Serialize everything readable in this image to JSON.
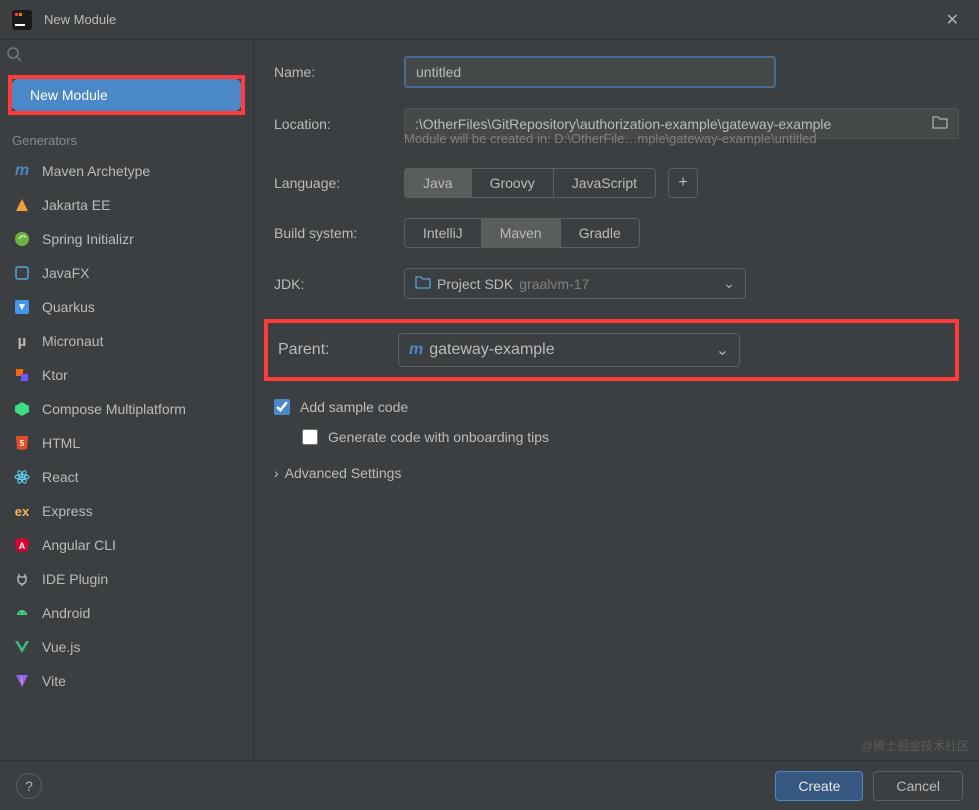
{
  "window": {
    "title": "New Module"
  },
  "sidebar": {
    "selected": "New Module",
    "section_label": "Generators",
    "items": [
      {
        "name": "maven-archetype",
        "label": "Maven Archetype",
        "icon": "maven-m-icon",
        "color": "#4A88C7"
      },
      {
        "name": "jakarta-ee",
        "label": "Jakarta EE",
        "icon": "jakarta-icon",
        "color": "#F29E38"
      },
      {
        "name": "spring-initializr",
        "label": "Spring Initializr",
        "icon": "spring-icon",
        "color": "#6DB33F"
      },
      {
        "name": "javafx",
        "label": "JavaFX",
        "icon": "javafx-icon",
        "color": "#53A3DA"
      },
      {
        "name": "quarkus",
        "label": "Quarkus",
        "icon": "quarkus-icon",
        "color": "#4695EB"
      },
      {
        "name": "micronaut",
        "label": "Micronaut",
        "icon": "micronaut-icon",
        "color": "#BBBBBB"
      },
      {
        "name": "ktor",
        "label": "Ktor",
        "icon": "ktor-icon",
        "color": "#F76707"
      },
      {
        "name": "compose-multiplatform",
        "label": "Compose Multiplatform",
        "icon": "compose-icon",
        "color": "#3DDC84"
      },
      {
        "name": "html",
        "label": "HTML",
        "icon": "html5-icon",
        "color": "#E44D26"
      },
      {
        "name": "react",
        "label": "React",
        "icon": "react-icon",
        "color": "#61DAFB"
      },
      {
        "name": "express",
        "label": "Express",
        "icon": "express-icon",
        "color": "#F4B459"
      },
      {
        "name": "angular-cli",
        "label": "Angular CLI",
        "icon": "angular-icon",
        "color": "#DD0031"
      },
      {
        "name": "ide-plugin",
        "label": "IDE Plugin",
        "icon": "plugin-icon",
        "color": "#AFB1B3"
      },
      {
        "name": "android",
        "label": "Android",
        "icon": "android-icon",
        "color": "#3DDC84"
      },
      {
        "name": "vuejs",
        "label": "Vue.js",
        "icon": "vue-icon",
        "color": "#42B883"
      },
      {
        "name": "vite",
        "label": "Vite",
        "icon": "vite-icon",
        "color": "#9461FB"
      }
    ]
  },
  "form": {
    "name_label": "Name:",
    "name_value": "untitled",
    "location_label": "Location:",
    "location_value": ":\\OtherFiles\\GitRepository\\authorization-example\\gateway-example",
    "location_hint": "Module will be created in: D:\\OtherFile…mple\\gateway-example\\untitled",
    "language_label": "Language:",
    "language_options": [
      {
        "label": "Java",
        "active": true
      },
      {
        "label": "Groovy",
        "active": false
      },
      {
        "label": "JavaScript",
        "active": false
      }
    ],
    "build_label": "Build system:",
    "build_options": [
      {
        "label": "IntelliJ",
        "active": false
      },
      {
        "label": "Maven",
        "active": true
      },
      {
        "label": "Gradle",
        "active": false
      }
    ],
    "jdk_label": "JDK:",
    "jdk_prefix": "Project SDK",
    "jdk_value": "graalvm-17",
    "parent_label": "Parent:",
    "parent_value": "gateway-example",
    "add_sample_label": "Add sample code",
    "add_sample_checked": true,
    "generate_tips_label": "Generate code with onboarding tips",
    "generate_tips_checked": false,
    "advanced_label": "Advanced Settings"
  },
  "footer": {
    "create": "Create",
    "cancel": "Cancel"
  },
  "watermark": "@稀土掘金技术社区"
}
